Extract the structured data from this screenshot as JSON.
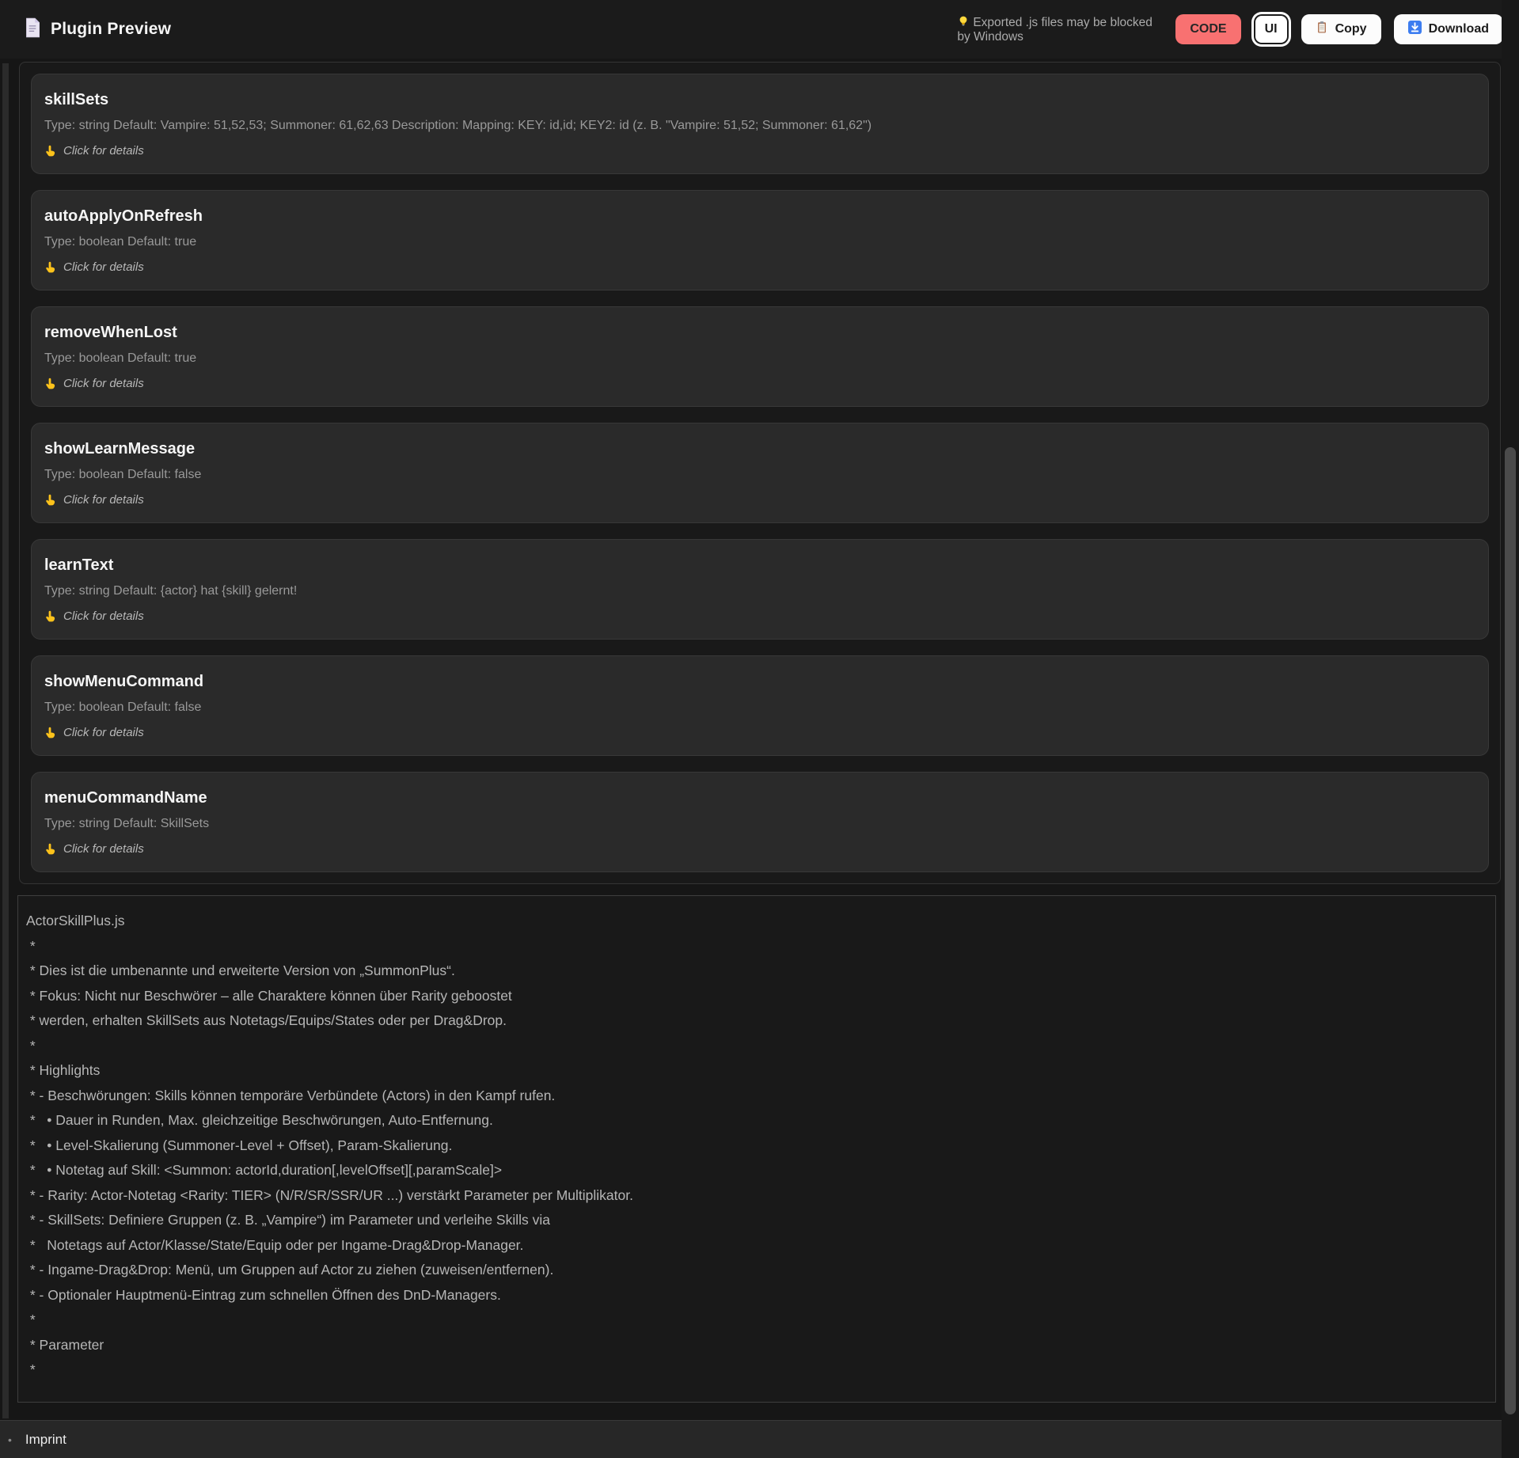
{
  "header": {
    "title": "Plugin Preview",
    "doc_icon": "document-icon",
    "warning": "Exported .js files may be blocked by Windows",
    "buttons": {
      "code": "CODE",
      "ui": "UI",
      "copy": "Copy",
      "download": "Download"
    }
  },
  "colors": {
    "code_button": "#f87171",
    "white_button": "#fcfcfc",
    "download_icon_blue": "#3d7df0",
    "bulb_yellow": "#ffd83d",
    "finger_yellow": "#fcc21b",
    "card_background": "#2a2a2a",
    "page_background": "#161616",
    "footer_background": "#272727"
  },
  "parameters": [
    {
      "name": "skillSets",
      "meta": "Type: string Default: Vampire: 51,52,53; Summoner: 61,62,63 Description: Mapping: KEY: id,id; KEY2: id (z. B. \"Vampire: 51,52; Summoner: 61,62\")",
      "details": "Click for details"
    },
    {
      "name": "autoApplyOnRefresh",
      "meta": "Type: boolean Default: true",
      "details": "Click for details"
    },
    {
      "name": "removeWhenLost",
      "meta": "Type: boolean Default: true",
      "details": "Click for details"
    },
    {
      "name": "showLearnMessage",
      "meta": "Type: boolean Default: false",
      "details": "Click for details"
    },
    {
      "name": "learnText",
      "meta": "Type: string Default: {actor} hat {skill} gelernt!",
      "details": "Click for details"
    },
    {
      "name": "showMenuCommand",
      "meta": "Type: boolean Default: false",
      "details": "Click for details"
    },
    {
      "name": "menuCommandName",
      "meta": "Type: string Default: SkillSets",
      "details": "Click for details"
    }
  ],
  "code_block": {
    "lines": [
      "ActorSkillPlus.js",
      " *",
      " * Dies ist die umbenannte und erweiterte Version von „SummonPlus“.",
      " * Fokus: Nicht nur Beschwörer – alle Charaktere können über Rarity geboostet",
      " * werden, erhalten SkillSets aus Notetags/Equips/States oder per Drag&Drop.",
      " *",
      " * Highlights",
      " * - Beschwörungen: Skills können temporäre Verbündete (Actors) in den Kampf rufen.",
      " *   • Dauer in Runden, Max. gleichzeitige Beschwörungen, Auto-Entfernung.",
      " *   • Level-Skalierung (Summoner-Level + Offset), Param-Skalierung.",
      " *   • Notetag auf Skill: <Summon: actorId,duration[,levelOffset][,paramScale]>",
      " * - Rarity: Actor-Notetag <Rarity: TIER> (N/R/SR/SSR/UR ...) verstärkt Parameter per Multiplikator.",
      " * - SkillSets: Definiere Gruppen (z. B. „Vampire“) im Parameter und verleihe Skills via",
      " *   Notetags auf Actor/Klasse/State/Equip oder per Ingame-Drag&Drop-Manager.",
      " * - Ingame-Drag&Drop: Menü, um Gruppen auf Actor zu ziehen (zuweisen/entfernen).",
      " * - Optionaler Hauptmenü-Eintrag zum schnellen Öffnen des DnD-Managers.",
      " *",
      " * Parameter",
      " *"
    ]
  },
  "footer": {
    "bullet": "•",
    "imprint": "Imprint"
  }
}
